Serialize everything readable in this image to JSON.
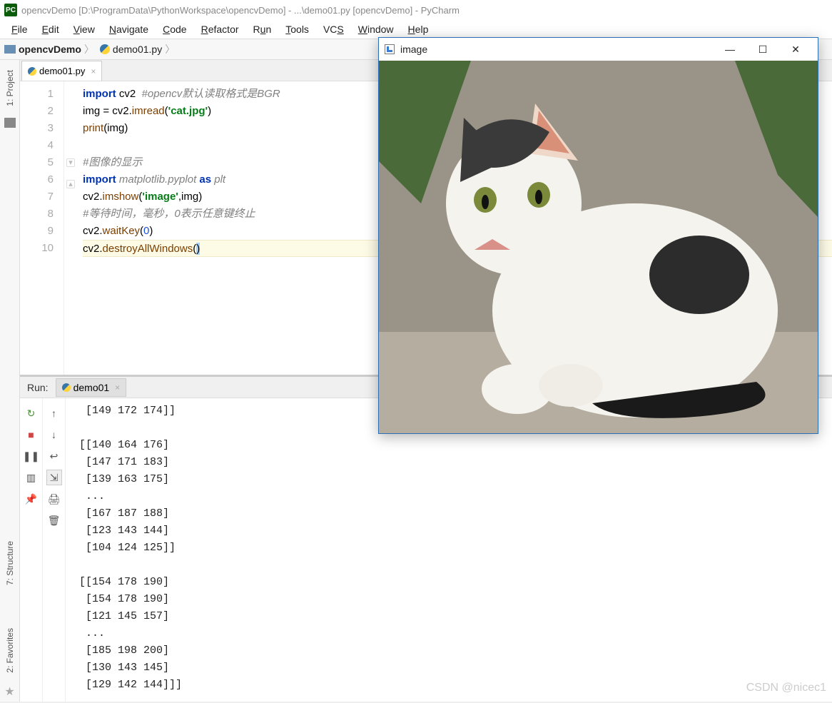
{
  "title_bar": {
    "logo_text": "PC",
    "title": "opencvDemo [D:\\ProgramData\\PythonWorkspace\\opencvDemo] - ...\\demo01.py [opencvDemo] - PyCharm"
  },
  "menu": {
    "file": "File",
    "edit": "Edit",
    "view": "View",
    "navigate": "Navigate",
    "code": "Code",
    "refactor": "Refactor",
    "run": "Run",
    "tools": "Tools",
    "vcs": "VCS",
    "window": "Window",
    "help": "Help"
  },
  "breadcrumb": {
    "project": "opencvDemo",
    "file": "demo01.py"
  },
  "left_strip": {
    "project": "1: Project",
    "structure": "7: Structure",
    "favorites": "2: Favorites"
  },
  "editor_tab": {
    "name": "demo01.py"
  },
  "code_lines": {
    "l1_kw": "import",
    "l1_mod": " cv2  ",
    "l1_cm": "#opencv默认读取格式是BGR",
    "l2a": "img = cv2.",
    "l2b": "imread",
    "l2c": "(",
    "l2s": "'cat.jpg'",
    "l2d": ")",
    "l3a": "print",
    "l3b": "(img)",
    "l4": "",
    "l5": "#图像的显示",
    "l6_kw": "import",
    "l6_mid": " matplotlib.pyplot ",
    "l6_as": "as",
    "l6_end": " plt",
    "l7a": "cv2.",
    "l7b": "imshow",
    "l7c": "(",
    "l7s": "'image'",
    "l7d": ",img)",
    "l8": "#等待时间，毫秒，0表示任意键终止",
    "l9a": "cv2.",
    "l9b": "waitKey",
    "l9c": "(",
    "l9n": "0",
    "l9d": ")",
    "l10a": "cv2.",
    "l10b": "destroyAllWindows",
    "l10c": "(",
    "l10d": ")"
  },
  "gutter": [
    "1",
    "2",
    "3",
    "4",
    "5",
    "6",
    "7",
    "8",
    "9",
    "10"
  ],
  "run": {
    "label": "Run:",
    "tab": "demo01"
  },
  "console_text": "  [149 172 174]]\n\n [[140 164 176]\n  [147 171 183]\n  [139 163 175]\n  ...\n  [167 187 188]\n  [123 143 144]\n  [104 124 125]]\n\n [[154 178 190]\n  [154 178 190]\n  [121 145 157]\n  ...\n  [185 198 200]\n  [130 143 145]\n  [129 142 144]]]",
  "image_window": {
    "title": "image",
    "minimize": "—",
    "maximize": "☐",
    "close": "✕"
  },
  "watermark": "CSDN @nicec1",
  "icons": {
    "rerun": "↻",
    "stop": "■",
    "pause": "❚❚",
    "layout": "▥",
    "pin": "📌",
    "up": "↑",
    "down": "↓",
    "wrap": "↩",
    "scroll": "⇲",
    "print": "🖨",
    "trash": "🗑"
  }
}
